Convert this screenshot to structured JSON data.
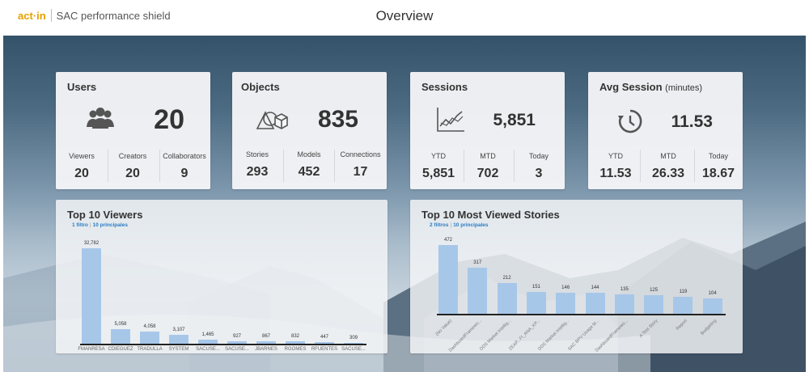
{
  "header": {
    "logo": "act·in",
    "app_name": "SAC performance shield",
    "title": "Overview"
  },
  "cards": {
    "users": {
      "title": "Users",
      "value": "20",
      "icon": "users-icon",
      "stats": [
        {
          "label": "Viewers",
          "value": "20"
        },
        {
          "label": "Creators",
          "value": "20"
        },
        {
          "label": "Collaborators",
          "value": "9"
        }
      ]
    },
    "objects": {
      "title": "Objects",
      "value": "835",
      "icon": "shapes-icon",
      "stats": [
        {
          "label": "Stories",
          "value": "293"
        },
        {
          "label": "Models",
          "value": "452"
        },
        {
          "label": "Connections",
          "value": "17"
        }
      ]
    },
    "sessions": {
      "title": "Sessions",
      "value": "5,851",
      "icon": "line-chart-icon",
      "stats": [
        {
          "label": "YTD",
          "value": "5,851"
        },
        {
          "label": "MTD",
          "value": "702"
        },
        {
          "label": "Today",
          "value": "3"
        }
      ]
    },
    "avg_session": {
      "title": "Avg Session",
      "subtitle": "(minutes)",
      "value": "11.53",
      "icon": "history-clock-icon",
      "stats": [
        {
          "label": "YTD",
          "value": "11.53"
        },
        {
          "label": "MTD",
          "value": "26.33"
        },
        {
          "label": "Today",
          "value": "18.67"
        }
      ]
    }
  },
  "top_viewers": {
    "title": "Top 10 Viewers",
    "filter_count": "1 filtro",
    "filter_rank": "10 principales"
  },
  "top_stories": {
    "title": "Top 10 Most Viewed Stories",
    "filter_count": "2 filtros",
    "filter_rank": "10 principales"
  },
  "colors": {
    "bar": "#a7c7e9",
    "filter_link": "#2a7bc2",
    "logo": "#e8a000"
  },
  "chart_data": [
    {
      "type": "bar",
      "title": "Top 10 Viewers",
      "categories": [
        "FMANRESA",
        "CDIEGUEZ",
        "TRADULLA",
        "SYSTEM",
        "SACUSE...",
        "SACUSE...",
        "JBARNES",
        "RGOMES",
        "RFUENTES",
        "SACUSE..."
      ],
      "values": [
        32782,
        5058,
        4058,
        3107,
        1465,
        927,
        867,
        832,
        447,
        309
      ],
      "value_labels": [
        "32,782",
        "5,058",
        "4,058",
        "3,107",
        "1,465",
        "927",
        "867",
        "832",
        "447",
        "309"
      ],
      "ylim": [
        0,
        32782
      ]
    },
    {
      "type": "bar",
      "title": "Top 10 Most Viewed Stories",
      "categories": [
        "(No Value)",
        "DashboardFramewo...",
        "DDS Market Intellig...",
        "ZEAP...FI_ANA_KP...",
        "DDS Market Intellig...",
        "SAC BPV Usage M...",
        "DashboardFramewo...",
        "A Test Story",
        "Report",
        "Budgeting"
      ],
      "values": [
        472,
        317,
        212,
        151,
        146,
        144,
        135,
        125,
        119,
        104
      ],
      "value_labels": [
        "472",
        "317",
        "212",
        "151",
        "146",
        "144",
        "135",
        "125",
        "119",
        "104"
      ],
      "ylim": [
        0,
        472
      ]
    }
  ]
}
